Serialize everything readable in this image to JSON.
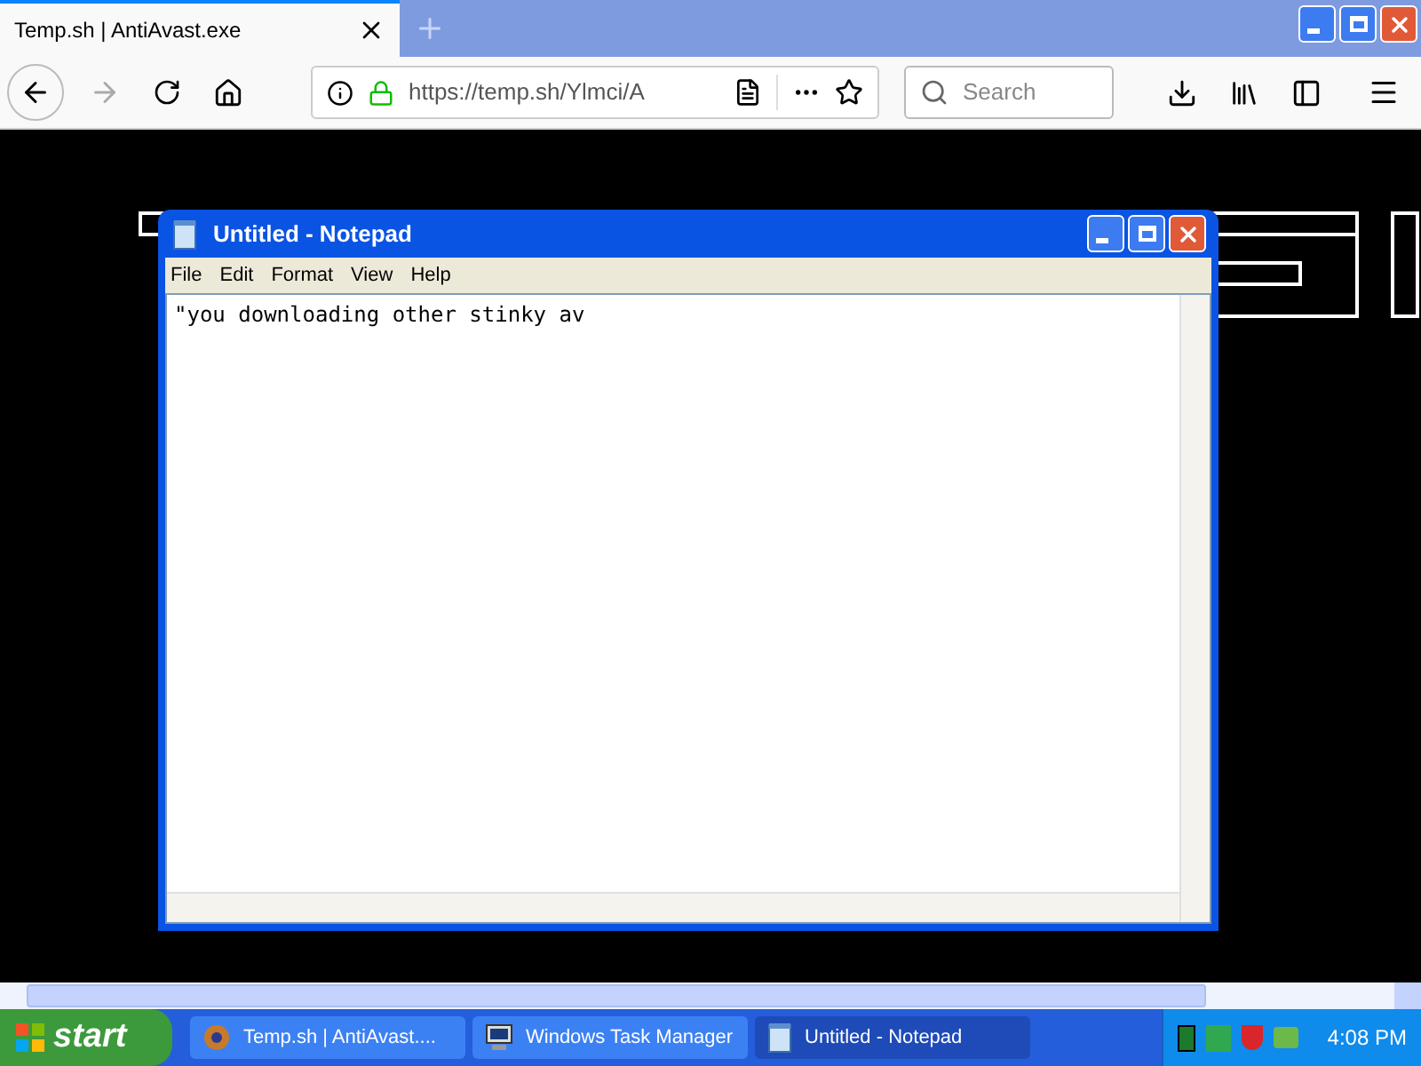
{
  "browser": {
    "tabs": [
      {
        "title": "Temp.sh | AntiAvast.exe",
        "selected": true
      }
    ],
    "url": "https://temp.sh/Ylmci/A",
    "search": {
      "placeholder": "Search"
    }
  },
  "notepad": {
    "title": "Untitled - Notepad",
    "menu": [
      "File",
      "Edit",
      "Format",
      "View",
      "Help"
    ],
    "text": "\"you downloading other stinky av"
  },
  "taskbar": {
    "start": "start",
    "items": [
      {
        "label": "Temp.sh | AntiAvast....",
        "kind": "browser",
        "selected": false
      },
      {
        "label": "Windows Task Manager",
        "kind": "taskmgr",
        "selected": false
      },
      {
        "label": "Untitled - Notepad",
        "kind": "notepad",
        "selected": true
      }
    ],
    "clock": "4:08 PM"
  }
}
